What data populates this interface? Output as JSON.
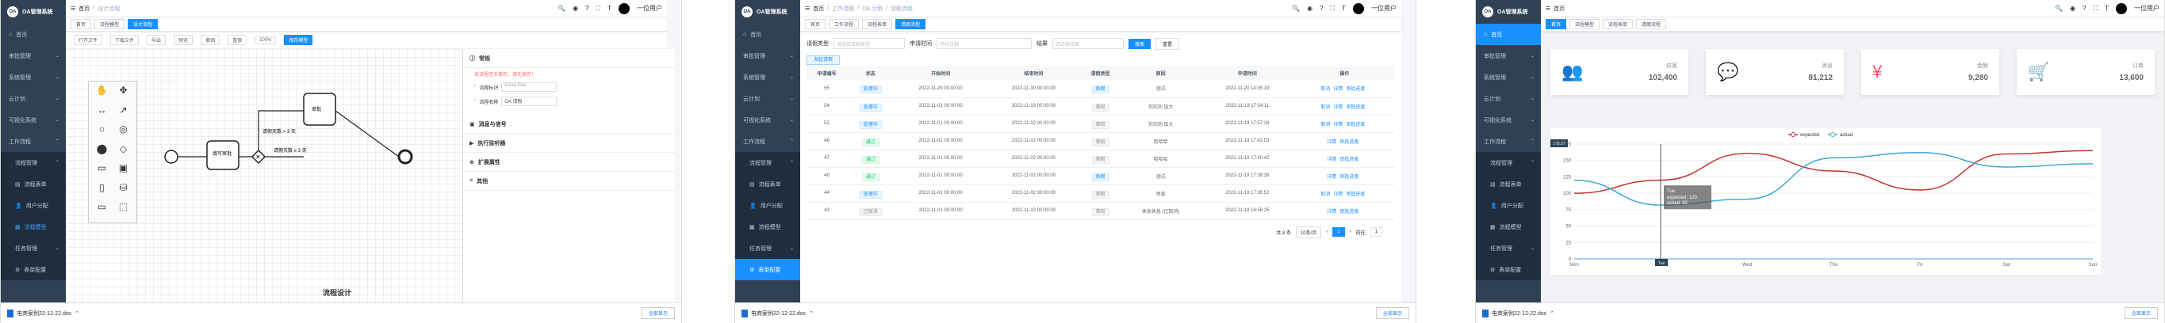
{
  "sidebar": {
    "logo": "OA管理系统",
    "logo_mark": "OA",
    "items": [
      "首页",
      "审批管理",
      "系统管理",
      "云计划",
      "可视化系统",
      "工作流程",
      "流程管理",
      "流程表单",
      "用户分配",
      "流程模型",
      "任务管理",
      "表单配置"
    ]
  },
  "nav": {
    "user": "一位用户"
  },
  "panel1": {
    "crumbs": [
      "首页",
      "/",
      "设计流程"
    ],
    "tags": [
      "首页",
      "流程模型",
      "设计流程"
    ],
    "toolbar": [
      "打开文件",
      "下载文件",
      "导出",
      "预览",
      "撤销",
      "重做",
      "100%",
      "保存模型"
    ],
    "labels": {
      "task1": "填写审批",
      "task2": "审批",
      "cond1": "请假天数 > 3 天",
      "cond2": "请假天数 ≤ 3 天",
      "watermark": "流程设计"
    },
    "props": {
      "general": "常规",
      "notice": "该流程还未保存，请先保存！",
      "id_label": "流程标识",
      "id_value": "leave-flow",
      "name_label": "流程名称",
      "name_value": "OA 请假",
      "sections": [
        "消息与信号",
        "执行监听器",
        "扩展属性",
        "其他"
      ]
    }
  },
  "panel2": {
    "crumbs": [
      "首页",
      "/",
      "工作流程",
      "/",
      "OA 示例",
      "/",
      "请假流程"
    ],
    "tags": [
      "首页",
      "工作流程",
      "流程表单",
      "请假流程"
    ],
    "filter": {
      "type_label": "请假类型",
      "type_ph": "请选择请假类型",
      "date_label": "申请时间",
      "date_ph": "开始日期",
      "status_label": "结果",
      "status_ph": "请选择结果",
      "search": "搜索",
      "reset": "重置",
      "add": "发起请假"
    },
    "columns": [
      "申请编号",
      "状态",
      "开始时间",
      "结束时间",
      "请假类型",
      "原因",
      "申请时间",
      "操作"
    ],
    "rows": [
      {
        "id": "55",
        "status": "处理中",
        "sc": "b",
        "start": "2022-11-29 00:00:00",
        "end": "2022-11-30 00:00:00",
        "type": "病假",
        "reason": "测试",
        "apply": "2022-11-20 14:35:19"
      },
      {
        "id": "54",
        "status": "处理中",
        "sc": "b",
        "start": "2022-11-01 00:00:00",
        "end": "2022-11-03 00:00:00",
        "type": "事假",
        "reason": "刘刘刘 加大",
        "apply": "2022-11-19 17:54:11"
      },
      {
        "id": "52",
        "status": "处理中",
        "sc": "b",
        "start": "2022-11-01 00:00:00",
        "end": "2022-11-02 00:00:00",
        "type": "事假",
        "reason": "刘刘刘 加大",
        "apply": "2022-11-19 17:57:34"
      },
      {
        "id": "48",
        "status": "通过",
        "sc": "g",
        "start": "2022-11-01 00:00:00",
        "end": "2022-11-02 00:00:00",
        "type": "事假",
        "reason": "哈哈哈",
        "apply": "2022-11-19 17:42:53"
      },
      {
        "id": "47",
        "status": "通过",
        "sc": "g",
        "start": "2022-11-01 00:00:00",
        "end": "2022-11-02 00:00:00",
        "type": "事假",
        "reason": "哈哈哈",
        "apply": "2022-11-19 17:40:42"
      },
      {
        "id": "46",
        "status": "通过",
        "sc": "g",
        "start": "2022-11-01 00:00:00",
        "end": "2022-11-02 00:00:00",
        "type": "病假",
        "reason": "测试",
        "apply": "2022-11-19 17:39:38"
      },
      {
        "id": "44",
        "status": "处理中",
        "sc": "b",
        "start": "2022-11-01 00:00:00",
        "end": "2022-11-02 00:00:00",
        "type": "事假",
        "reason": "休息",
        "apply": "2022-11-19 17:35:52"
      },
      {
        "id": "43",
        "status": "已取消",
        "sc": "gy",
        "start": "2022-11-01 00:00:00",
        "end": "2022-11-02 00:00:00",
        "type": "事假",
        "reason": "休息休息 (已取消)",
        "apply": "2022-11-19 16:56:25"
      }
    ],
    "ops": {
      "detail": "详情",
      "progress": "审批进度",
      "cancel": "取消"
    },
    "pager": {
      "total": "共 8 条",
      "size": "10条/页",
      "page": "1",
      "goto": "前往",
      "goto_val": "1"
    }
  },
  "panel3": {
    "crumbs": [
      "首页"
    ],
    "tags": [
      "首页",
      "流程模型",
      "流程表单",
      "请假流程"
    ],
    "cards": [
      {
        "label": "访客",
        "value": "102,400",
        "icon": "users-icon",
        "color": "#40c9c6",
        "glyph": "👥"
      },
      {
        "label": "消息",
        "value": "81,212",
        "icon": "message-icon",
        "color": "#36a3f7",
        "glyph": "💬"
      },
      {
        "label": "金额",
        "value": "9,280",
        "icon": "money-icon",
        "color": "#f4516c",
        "glyph": "¥"
      },
      {
        "label": "订单",
        "value": "13,600",
        "icon": "cart-icon",
        "color": "#34bfa3",
        "glyph": "🛒"
      }
    ]
  },
  "taskbar": {
    "file": "电商案例22-12-22.doc",
    "show_all": "全部显示"
  },
  "chart_data": {
    "type": "line",
    "categories": [
      "Mon",
      "Tue",
      "Wed",
      "Thu",
      "Fri",
      "Sat",
      "Sun"
    ],
    "series": [
      {
        "name": "expected",
        "values": [
          100,
          120,
          161,
          134,
          105,
          160,
          165
        ],
        "color": "#c23531"
      },
      {
        "name": "actual",
        "values": [
          120,
          82,
          91,
          154,
          162,
          140,
          145
        ],
        "color": "#40a8d4"
      }
    ],
    "ylim": [
      0,
      175
    ],
    "yticks": [
      0,
      25,
      50,
      75,
      100,
      125,
      150,
      175
    ],
    "legend": "top",
    "tooltip": {
      "title": "Tue",
      "lines": [
        "expected: 120",
        "actual: 82"
      ]
    },
    "pointer_label": "175.27"
  }
}
